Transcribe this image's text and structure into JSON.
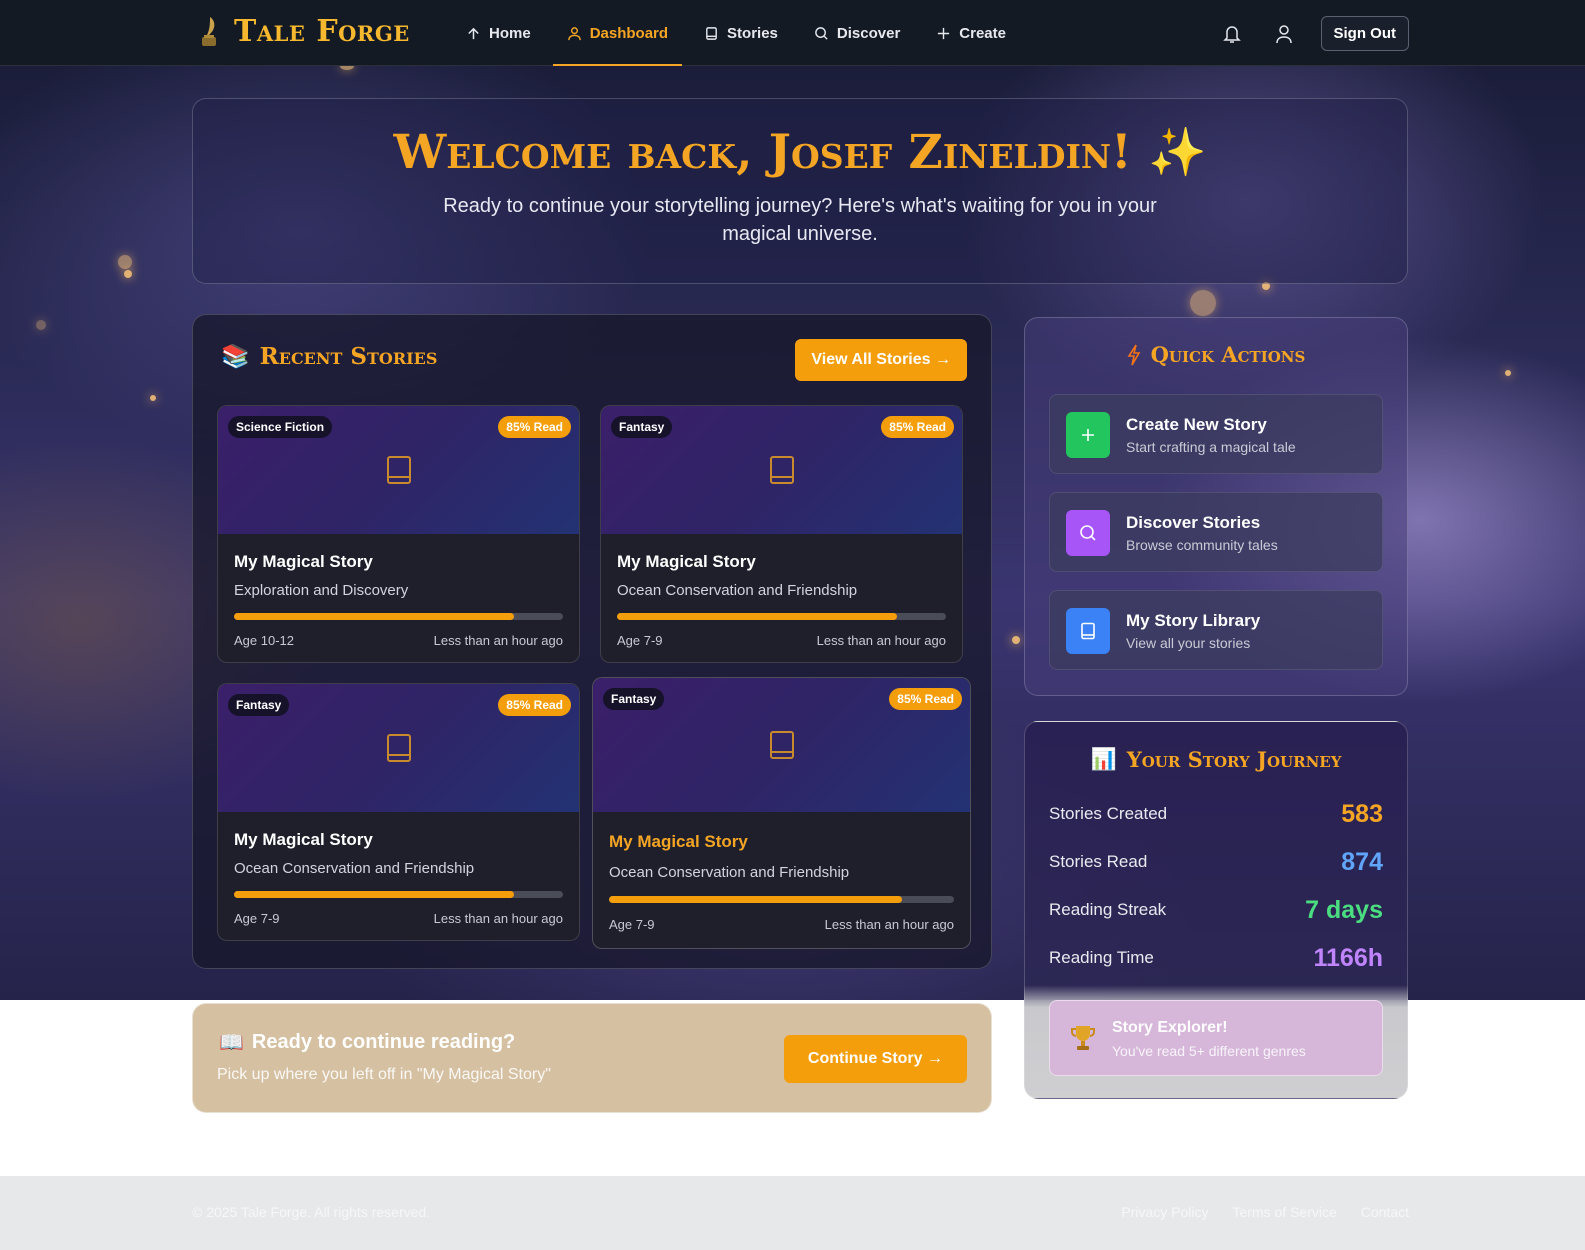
{
  "brand": {
    "title": "Tale Forge",
    "logo_icon": "quill-ink-icon"
  },
  "nav": {
    "links": [
      {
        "label": "Home",
        "icon": "arrow-up-icon"
      },
      {
        "label": "Dashboard",
        "icon": "user-icon",
        "active": true
      },
      {
        "label": "Stories",
        "icon": "book-icon"
      },
      {
        "label": "Discover",
        "icon": "search-icon"
      },
      {
        "label": "Create",
        "icon": "plus-icon"
      }
    ],
    "notifications_icon": "bell-icon",
    "profile_icon": "user-icon",
    "sign_out": "Sign Out"
  },
  "welcome": {
    "title": "Welcome back, Josef Zineldin! ✨",
    "subtitle": "Ready to continue your storytelling journey? Here's what's waiting for you in your magical universe."
  },
  "recent": {
    "title": "Recent Stories",
    "title_icon": "📚",
    "view_all": "View All Stories →",
    "cards": [
      {
        "genre": "Science Fiction",
        "read": "85% Read",
        "progress": 0.85,
        "title": "My Magical Story",
        "subtitle": "Exploration and Discovery",
        "age": "Age 10-12",
        "time": "Less than an hour ago"
      },
      {
        "genre": "Fantasy",
        "read": "85% Read",
        "progress": 0.85,
        "title": "My Magical Story",
        "subtitle": "Ocean Conservation and Friendship",
        "age": "Age 7-9",
        "time": "Less than an hour ago"
      },
      {
        "genre": "Fantasy",
        "read": "85% Read",
        "progress": 0.85,
        "title": "My Magical Story",
        "subtitle": "Ocean Conservation and Friendship",
        "age": "Age 7-9",
        "time": "Less than an hour ago"
      },
      {
        "genre": "Fantasy",
        "read": "85% Read",
        "progress": 0.85,
        "title": "My Magical Story",
        "subtitle": "Ocean Conservation and Friendship",
        "age": "Age 7-9",
        "time": "Less than an hour ago"
      }
    ]
  },
  "quick_actions": {
    "title": "Quick Actions",
    "items": [
      {
        "title": "Create New Story",
        "subtitle": "Start crafting a magical tale",
        "icon": "plus-icon",
        "color": "#22c55e"
      },
      {
        "title": "Discover Stories",
        "subtitle": "Browse community tales",
        "icon": "search-icon",
        "color": "#a855f7"
      },
      {
        "title": "My Story Library",
        "subtitle": "View all your stories",
        "icon": "book-icon",
        "color": "#3b82f6"
      }
    ]
  },
  "journey": {
    "title": "Your Story Journey",
    "title_icon": "📊",
    "stats": [
      {
        "label": "Stories Created",
        "value": "583",
        "color": "#f5a524"
      },
      {
        "label": "Stories Read",
        "value": "874",
        "color": "#60a5fa"
      },
      {
        "label": "Reading Streak",
        "value": "7 days",
        "color": "#4ade80"
      },
      {
        "label": "Reading Time",
        "value": "1166h",
        "color": "#c084fc"
      }
    ],
    "badge": {
      "title": "Story Explorer!",
      "subtitle": "You've read 5+ different genres",
      "icon": "trophy-icon"
    }
  },
  "continue_reading": {
    "icon": "📖",
    "title": "Ready to continue reading?",
    "subtitle": "Pick up where you left off in \"My Magical Story\"",
    "button": "Continue Story →"
  },
  "footer": {
    "copyright": "© 2025 Tale Forge. All rights reserved.",
    "links": [
      "Privacy Policy",
      "Terms of Service",
      "Contact"
    ]
  }
}
